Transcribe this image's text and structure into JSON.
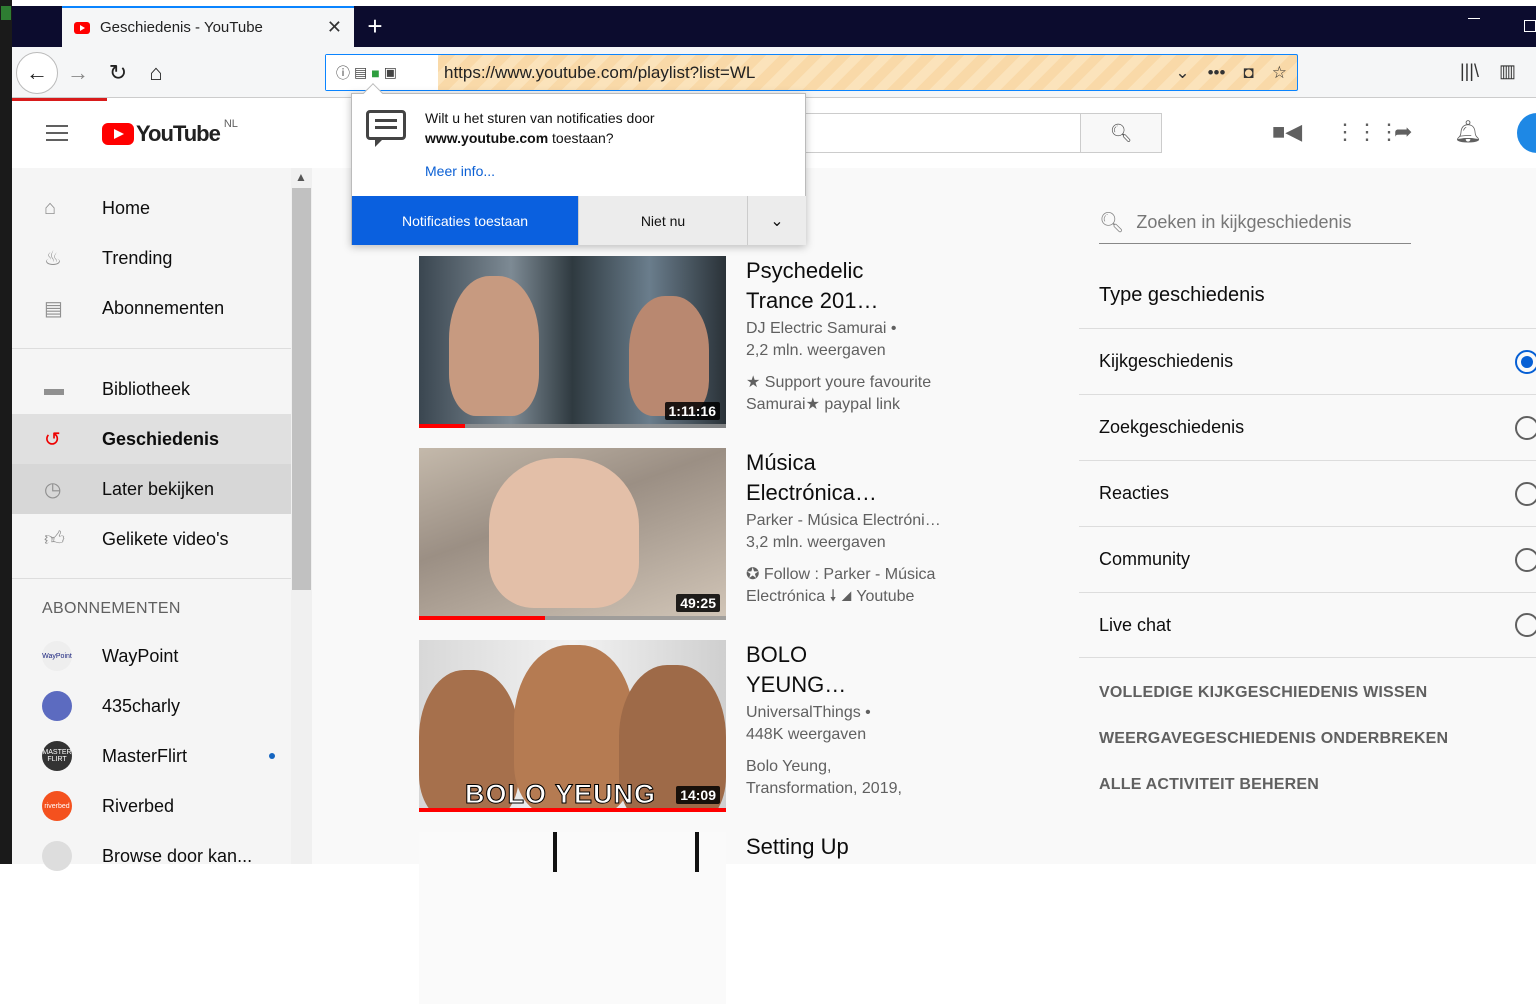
{
  "browser": {
    "tab_title": "Geschiedenis - YouTube",
    "new_tab": "+",
    "url": "https://www.youtube.com/playlist?list=WL",
    "close_tab": "✕"
  },
  "youtube": {
    "logo_text": "YouTube",
    "country": "NL"
  },
  "notification": {
    "line1": "Wilt u het sturen van notificaties door",
    "domain": "www.youtube.com",
    "line2_suffix": " toestaan?",
    "more_info": "Meer info...",
    "allow": "Notificaties toestaan",
    "not_now": "Niet nu"
  },
  "sidebar": {
    "items": [
      {
        "label": "Home",
        "icon": "home-icon"
      },
      {
        "label": "Trending",
        "icon": "fire-icon"
      },
      {
        "label": "Abonnementen",
        "icon": "subscriptions-icon"
      },
      {
        "label": "Bibliotheek",
        "icon": "folder-icon"
      },
      {
        "label": "Geschiedenis",
        "icon": "history-icon"
      },
      {
        "label": "Later bekijken",
        "icon": "clock-icon"
      },
      {
        "label": "Gelikete video's",
        "icon": "thumbs-up-icon"
      }
    ],
    "subs_heading": "ABONNEMENTEN",
    "subs": [
      {
        "label": "WayPoint",
        "avatar_text": "WayPoint"
      },
      {
        "label": "435charly",
        "avatar_text": ""
      },
      {
        "label": "MasterFlirt",
        "avatar_text": "MASTER FLIRT"
      },
      {
        "label": "Riverbed",
        "avatar_text": "riverbed"
      },
      {
        "label": "Browse door kan...",
        "avatar_text": ""
      }
    ]
  },
  "videos": [
    {
      "title1": "Psychedelic",
      "title2": "Trance 201…",
      "channel": "DJ Electric Samurai •",
      "views": "2,2 mln. weergaven",
      "desc1": "★ Support youre favourite",
      "desc2": "Samurai★ paypal link",
      "duration": "1:11:16",
      "progress": 0.15
    },
    {
      "title1": "Música",
      "title2": "Electrónica…",
      "channel": "Parker - Música Electróni…",
      "views": "3,2 mln. weergaven",
      "desc1": "✪ Follow : Parker - Música",
      "desc2": "Electrónica 🠗 ◢ Youtube",
      "duration": "49:25",
      "progress": 0.41
    },
    {
      "title1": "BOLO",
      "title2": "YEUNG…",
      "channel": "UniversalThings •",
      "views": "448K weergaven",
      "desc1": "Bolo Yeung,",
      "desc2": "Transformation, 2019,",
      "duration": "14:09",
      "progress": 1.0,
      "thumb_text": "BOLO YEUNG"
    },
    {
      "title1": "Setting Up",
      "title2": "",
      "channel": "",
      "views": "",
      "desc1": "",
      "desc2": "",
      "duration": "",
      "progress": 0
    }
  ],
  "right_panel": {
    "search_placeholder": "Zoeken in kijkgeschiedenis",
    "type_heading": "Type geschiedenis",
    "options": [
      "Kijkgeschiedenis",
      "Zoekgeschiedenis",
      "Reacties",
      "Community",
      "Live chat"
    ],
    "selected": "Kijkgeschiedenis",
    "actions": [
      "VOLLEDIGE KIJKGESCHIEDENIS WISSEN",
      "WEERGAVEGESCHIEDENIS ONDERBREKEN",
      "ALLE ACTIVITEIT BEHEREN"
    ]
  },
  "colors": {
    "accent": "#065fd4",
    "brand": "#ff0000",
    "allow_button": "#0a60df"
  }
}
